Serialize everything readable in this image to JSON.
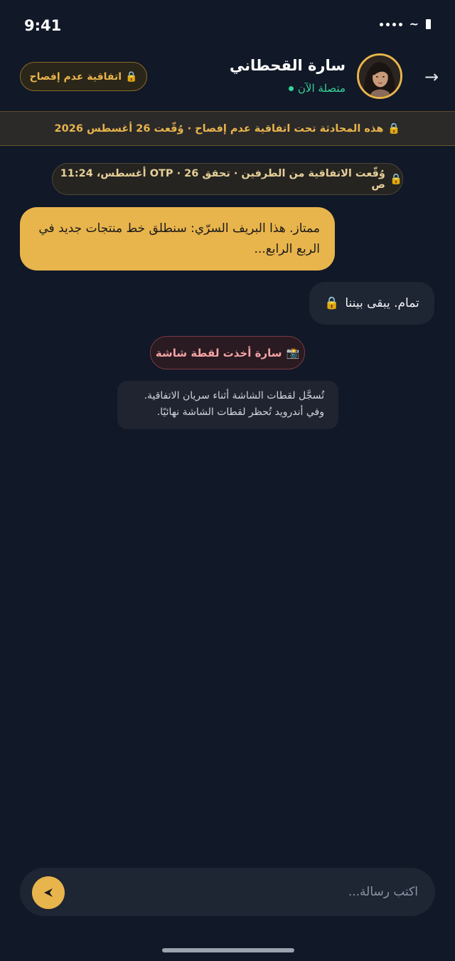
{
  "status_bar": {
    "time": "9:41",
    "wifi_icon": "~"
  },
  "header": {
    "back_icon": "→",
    "contact_name": "سارة القحطاني",
    "contact_status": "متصلة الآن",
    "nda_pill": {
      "icon": "🔒",
      "label": "اتفاقية عدم إفصاح"
    }
  },
  "banner": {
    "icon": "🔒",
    "text": "هذه المحادثة تحت اتفاقية عدم إفصاح · وُقّعت 26 أغسطس 2026"
  },
  "messages": {
    "signed_notice": {
      "icon": "🔒",
      "text": "وُقّعت الاتفاقية من الطرفين · تحقق OTP · 26 أغسطس، 11:24 ص"
    },
    "incoming_1": "ممتاز. هذا البريف السرّي: سنطلق خط منتجات جديد في الربع الرابع...",
    "outgoing_1": {
      "text": "تمام. يبقى بيننا",
      "icon": "🔒"
    },
    "screenshot_alert": {
      "icon": "📸",
      "text": "سارة أخذت لقطة شاشة"
    },
    "screenshot_note": {
      "line1": "تُسجَّل لقطات الشاشة أثناء سريان الاتفاقية.",
      "line2": "وفي أندرويد تُحظر لقطات الشاشة نهائيًا."
    }
  },
  "composer": {
    "placeholder": "اكتب رسالة...",
    "send_icon": "➤"
  },
  "colors": {
    "background": "#111827",
    "accent_gold": "#e8b44c",
    "online_green": "#34d399",
    "alert_red": "#f4a4a4"
  }
}
